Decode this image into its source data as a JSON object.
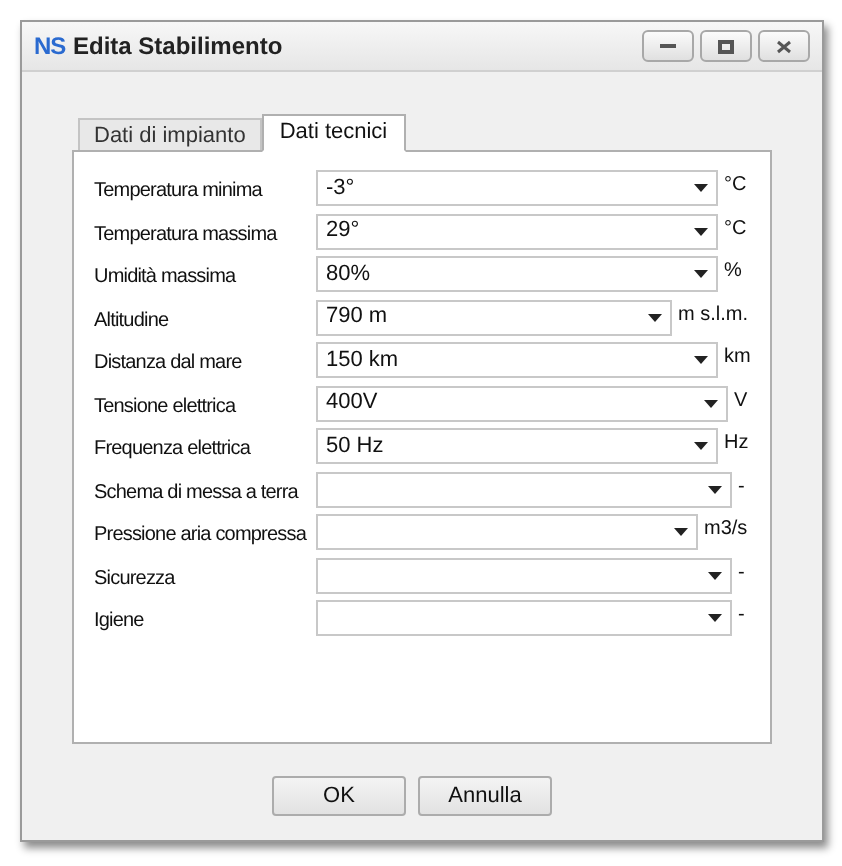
{
  "window": {
    "logo": "NS",
    "title": "Edita Stabilimento"
  },
  "tabs": [
    {
      "label": "Dati di impianto",
      "selected": false
    },
    {
      "label": "Dati tecnici",
      "selected": true
    }
  ],
  "fields": [
    {
      "label": "Temperatura minima",
      "value": "-3°",
      "unit": "°C"
    },
    {
      "label": "Temperatura massima",
      "value": "29°",
      "unit": "°C"
    },
    {
      "label": "Umidità massima",
      "value": "80%",
      "unit": "%"
    },
    {
      "label": "Altitudine",
      "value": "790 m",
      "unit": "m s.l.m."
    },
    {
      "label": "Distanza dal mare",
      "value": "150 km",
      "unit": "km"
    },
    {
      "label": "Tensione elettrica",
      "value": "400V",
      "unit": "V"
    },
    {
      "label": "Frequenza elettrica",
      "value": "50 Hz",
      "unit": "Hz"
    },
    {
      "label": "Schema di messa a terra",
      "unit": "-"
    },
    {
      "label": "Pressione aria compressa",
      "unit": "m3/s"
    },
    {
      "label": "Sicurezza",
      "unit": "-"
    },
    {
      "label": "Igiene",
      "unit": "-"
    }
  ],
  "buttons": [
    "OK",
    "Annulla"
  ]
}
